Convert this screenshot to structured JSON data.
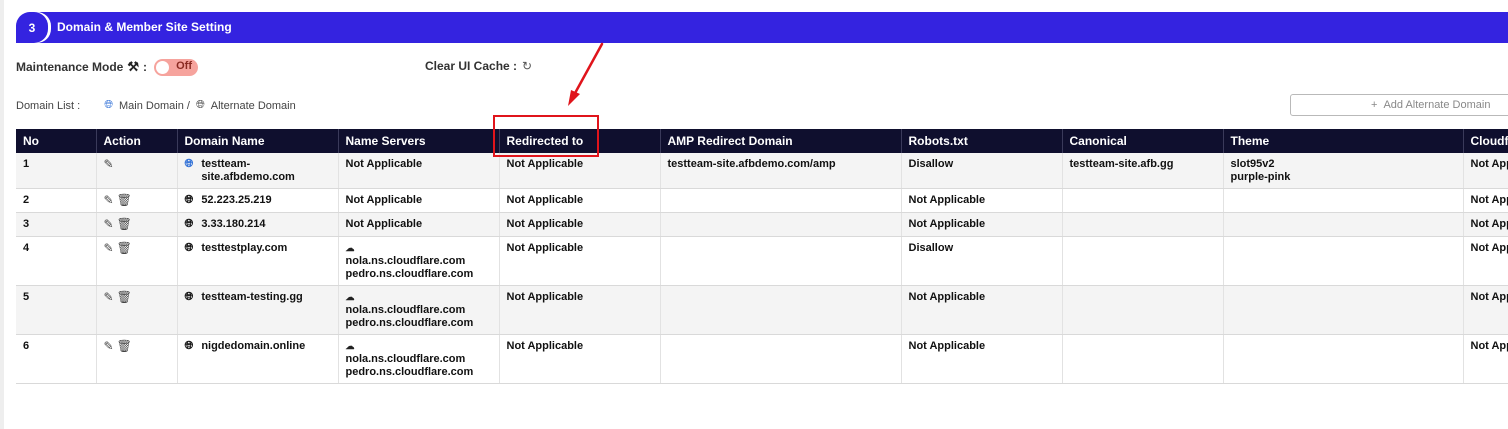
{
  "section": {
    "step": "3",
    "title": "Domain & Member Site Setting"
  },
  "maintenance": {
    "label": "Maintenance Mode",
    "icon": "tools-icon",
    "colon": ":",
    "toggle_label": "Off",
    "toggle_color": "#f6a39d"
  },
  "cache": {
    "label": "Clear UI Cache :",
    "icon": "refresh-icon"
  },
  "legend": {
    "label": "Domain List :",
    "main": "Main Domain /",
    "alternate": "Alternate Domain"
  },
  "add_button": {
    "icon": "+",
    "label": "Add Alternate Domain"
  },
  "colors": {
    "header_bar": "#3423e0",
    "table_header": "#0f0f2e",
    "annotation": "#e0141b",
    "main_domain_globe": "#2f6fd6"
  },
  "table": {
    "columns": [
      "No",
      "Action",
      "Domain Name",
      "Name Servers",
      "Redirected to",
      "AMP Redirect Domain",
      "Robots.txt",
      "Canonical",
      "Theme",
      "Cloudflare"
    ],
    "rows": [
      {
        "no": "1",
        "main": true,
        "delete": false,
        "domain": [
          "testteam-",
          "site.afbdemo.com"
        ],
        "ns_cloud": false,
        "ns": [
          "Not Applicable"
        ],
        "redirect": "Not Applicable",
        "amp": "testteam-site.afbdemo.com/amp",
        "robots": "Disallow",
        "canonical": "testteam-site.afb.gg",
        "theme": [
          "slot95v2",
          "purple-pink"
        ],
        "cloudflare": "Not Applicable"
      },
      {
        "no": "2",
        "main": false,
        "delete": true,
        "domain": [
          "52.223.25.219"
        ],
        "ns_cloud": false,
        "ns": [
          "Not Applicable"
        ],
        "redirect": "Not Applicable",
        "amp": "",
        "robots": "Not Applicable",
        "canonical": "",
        "theme": [],
        "cloudflare": "Not Applicable"
      },
      {
        "no": "3",
        "main": false,
        "delete": true,
        "domain": [
          "3.33.180.214"
        ],
        "ns_cloud": false,
        "ns": [
          "Not Applicable"
        ],
        "redirect": "Not Applicable",
        "amp": "",
        "robots": "Not Applicable",
        "canonical": "",
        "theme": [],
        "cloudflare": "Not Applicable"
      },
      {
        "no": "4",
        "main": false,
        "delete": true,
        "domain": [
          "testtestplay.com"
        ],
        "ns_cloud": true,
        "ns": [
          "nola.ns.cloudflare.com",
          "pedro.ns.cloudflare.com"
        ],
        "redirect": "Not Applicable",
        "amp": "",
        "robots": "Disallow",
        "canonical": "",
        "theme": [],
        "cloudflare": "Not Applicable"
      },
      {
        "no": "5",
        "main": false,
        "delete": true,
        "domain": [
          "testteam-testing.gg"
        ],
        "ns_cloud": true,
        "ns": [
          "nola.ns.cloudflare.com",
          "pedro.ns.cloudflare.com"
        ],
        "redirect": "Not Applicable",
        "amp": "",
        "robots": "Not Applicable",
        "canonical": "",
        "theme": [],
        "cloudflare": "Not Applicable"
      },
      {
        "no": "6",
        "main": false,
        "delete": true,
        "domain": [
          "nigdedomain.online"
        ],
        "ns_cloud": true,
        "ns": [
          "nola.ns.cloudflare.com",
          "pedro.ns.cloudflare.com"
        ],
        "redirect": "Not Applicable",
        "amp": "",
        "robots": "Not Applicable",
        "canonical": "",
        "theme": [],
        "cloudflare": "Not Applicable"
      }
    ]
  }
}
